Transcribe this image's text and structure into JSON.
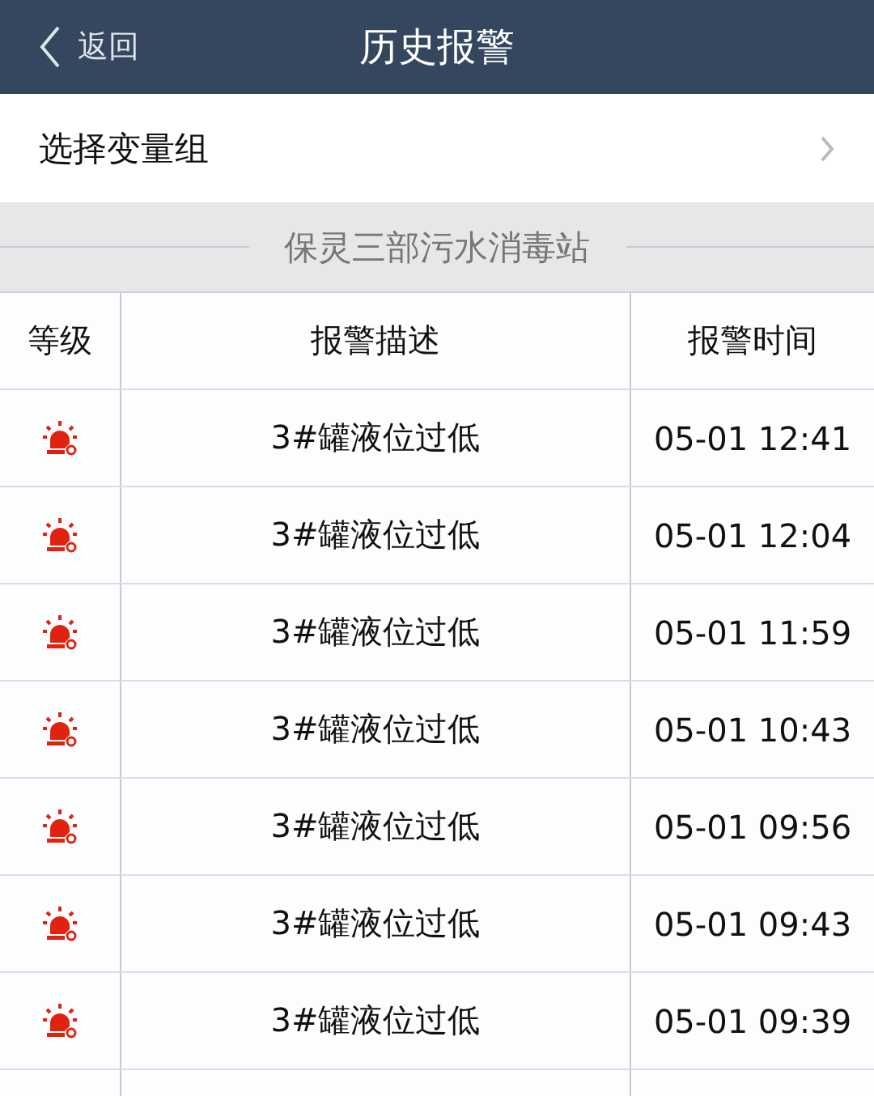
{
  "nav": {
    "back": "返回",
    "title": "历史报警"
  },
  "selector": {
    "label": "选择变量组"
  },
  "section": "保灵三部污水消毒站",
  "table": {
    "columns": [
      "等级",
      "报警描述",
      "报警时间"
    ],
    "rows": [
      {
        "kind": "alarm",
        "description": "3#罐液位过低",
        "time": "05-01 12:41"
      },
      {
        "kind": "alarm",
        "description": "3#罐液位过低",
        "time": "05-01 12:04"
      },
      {
        "kind": "alarm",
        "description": "3#罐液位过低",
        "time": "05-01 11:59"
      },
      {
        "kind": "alarm",
        "description": "3#罐液位过低",
        "time": "05-01 10:43"
      },
      {
        "kind": "alarm",
        "description": "3#罐液位过低",
        "time": "05-01 09:56"
      },
      {
        "kind": "alarm",
        "description": "3#罐液位过低",
        "time": "05-01 09:43"
      },
      {
        "kind": "alarm",
        "description": "3#罐液位过低",
        "time": "05-01 09:39"
      }
    ]
  }
}
